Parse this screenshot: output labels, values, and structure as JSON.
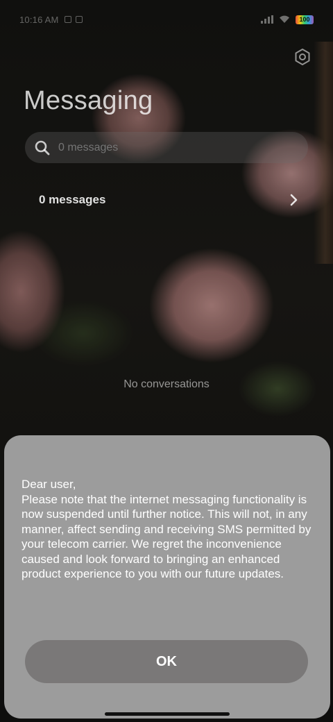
{
  "status_bar": {
    "time": "10:16 AM",
    "battery": "100"
  },
  "header": {
    "title": "Messaging",
    "settings_icon": "settings-gear-icon"
  },
  "search": {
    "placeholder": "0 messages",
    "icon": "search-icon"
  },
  "messages_row": {
    "label": "0 messages",
    "icon": "chevron-right-icon"
  },
  "empty_state": {
    "text": "No conversations"
  },
  "dialog": {
    "message": "Dear user,\nPlease note that the internet messaging functionality is now suspended until further notice. This will not, in any manner, affect sending and receiving SMS permitted by your telecom carrier. We regret the inconvenience caused and look forward to bringing an enhanced product experience to you with our future updates.",
    "ok_label": "OK"
  },
  "colors": {
    "dialog_bg": "#9c9c9c",
    "button_bg": "#7a7878"
  }
}
